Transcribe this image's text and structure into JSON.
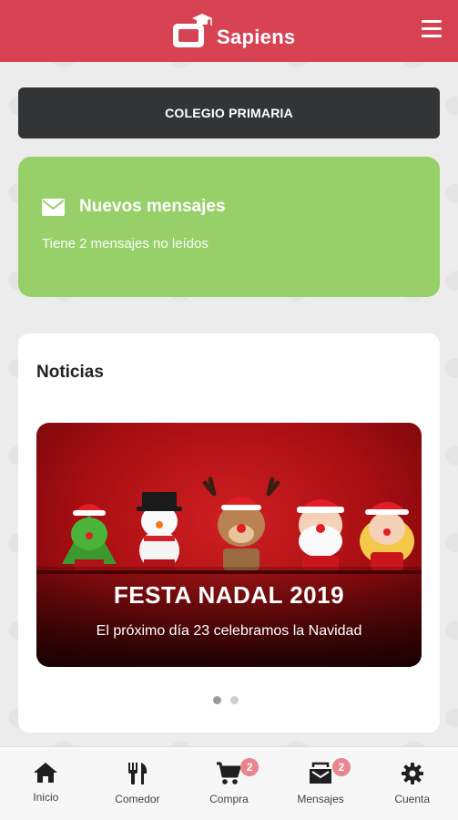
{
  "header": {
    "app_name": "Sapiens",
    "brand_color": "#d84354",
    "menu_icon": "hamburger-icon"
  },
  "school": {
    "label": "COLEGIO PRIMARIA"
  },
  "messages_card": {
    "icon": "envelope-icon",
    "title": "Nuevos mensajes",
    "subtitle": "Tiene 2 mensajes no leídos",
    "color": "#97d068"
  },
  "news": {
    "title": "Noticias",
    "slides": [
      {
        "title": "FESTA NADAL 2019",
        "text": "El próximo día 23 celebramos la Navidad"
      }
    ],
    "active_slide": 1,
    "slide_count": 2
  },
  "tabbar": {
    "items": [
      {
        "label": "Inicio",
        "icon": "home-icon",
        "badge": ""
      },
      {
        "label": "Comedor",
        "icon": "fork-knife-icon",
        "badge": ""
      },
      {
        "label": "Compra",
        "icon": "cart-icon",
        "badge": "2"
      },
      {
        "label": "Mensajes",
        "icon": "inbox-icon",
        "badge": "2"
      },
      {
        "label": "Cuenta",
        "icon": "gear-icon",
        "badge": ""
      }
    ],
    "badge_color": "#e8858f"
  }
}
